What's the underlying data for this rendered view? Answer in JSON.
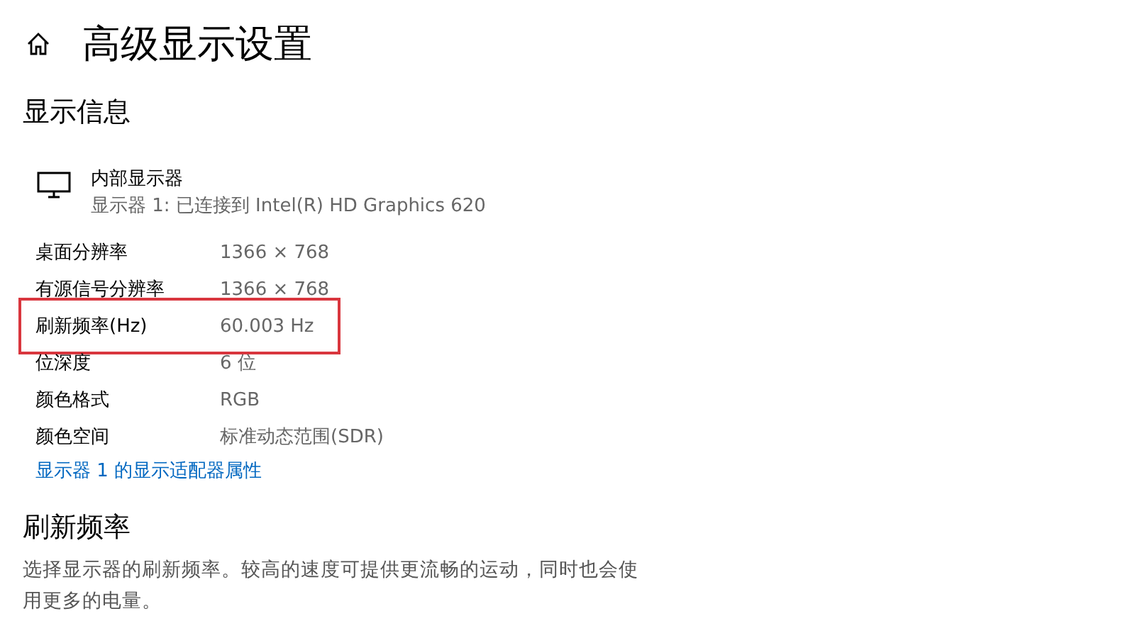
{
  "header": {
    "title": "高级显示设置"
  },
  "display_info": {
    "heading": "显示信息",
    "monitor": {
      "name": "内部显示器",
      "description": "显示器 1: 已连接到 Intel(R) HD Graphics 620"
    },
    "rows": [
      {
        "label": "桌面分辨率",
        "value": "1366 × 768",
        "highlighted": false
      },
      {
        "label": "有源信号分辨率",
        "value": "1366 × 768",
        "highlighted": false
      },
      {
        "label": "刷新频率(Hz)",
        "value": "60.003 Hz",
        "highlighted": true
      },
      {
        "label": "位深度",
        "value": "6 位",
        "highlighted": false
      },
      {
        "label": "颜色格式",
        "value": "RGB",
        "highlighted": false
      },
      {
        "label": "颜色空间",
        "value": "标准动态范围(SDR)",
        "highlighted": false
      }
    ],
    "link": "显示器 1 的显示适配器属性"
  },
  "refresh_rate": {
    "heading": "刷新频率",
    "description": "选择显示器的刷新频率。较高的速度可提供更流畅的运动，同时也会使用更多的电量。"
  }
}
